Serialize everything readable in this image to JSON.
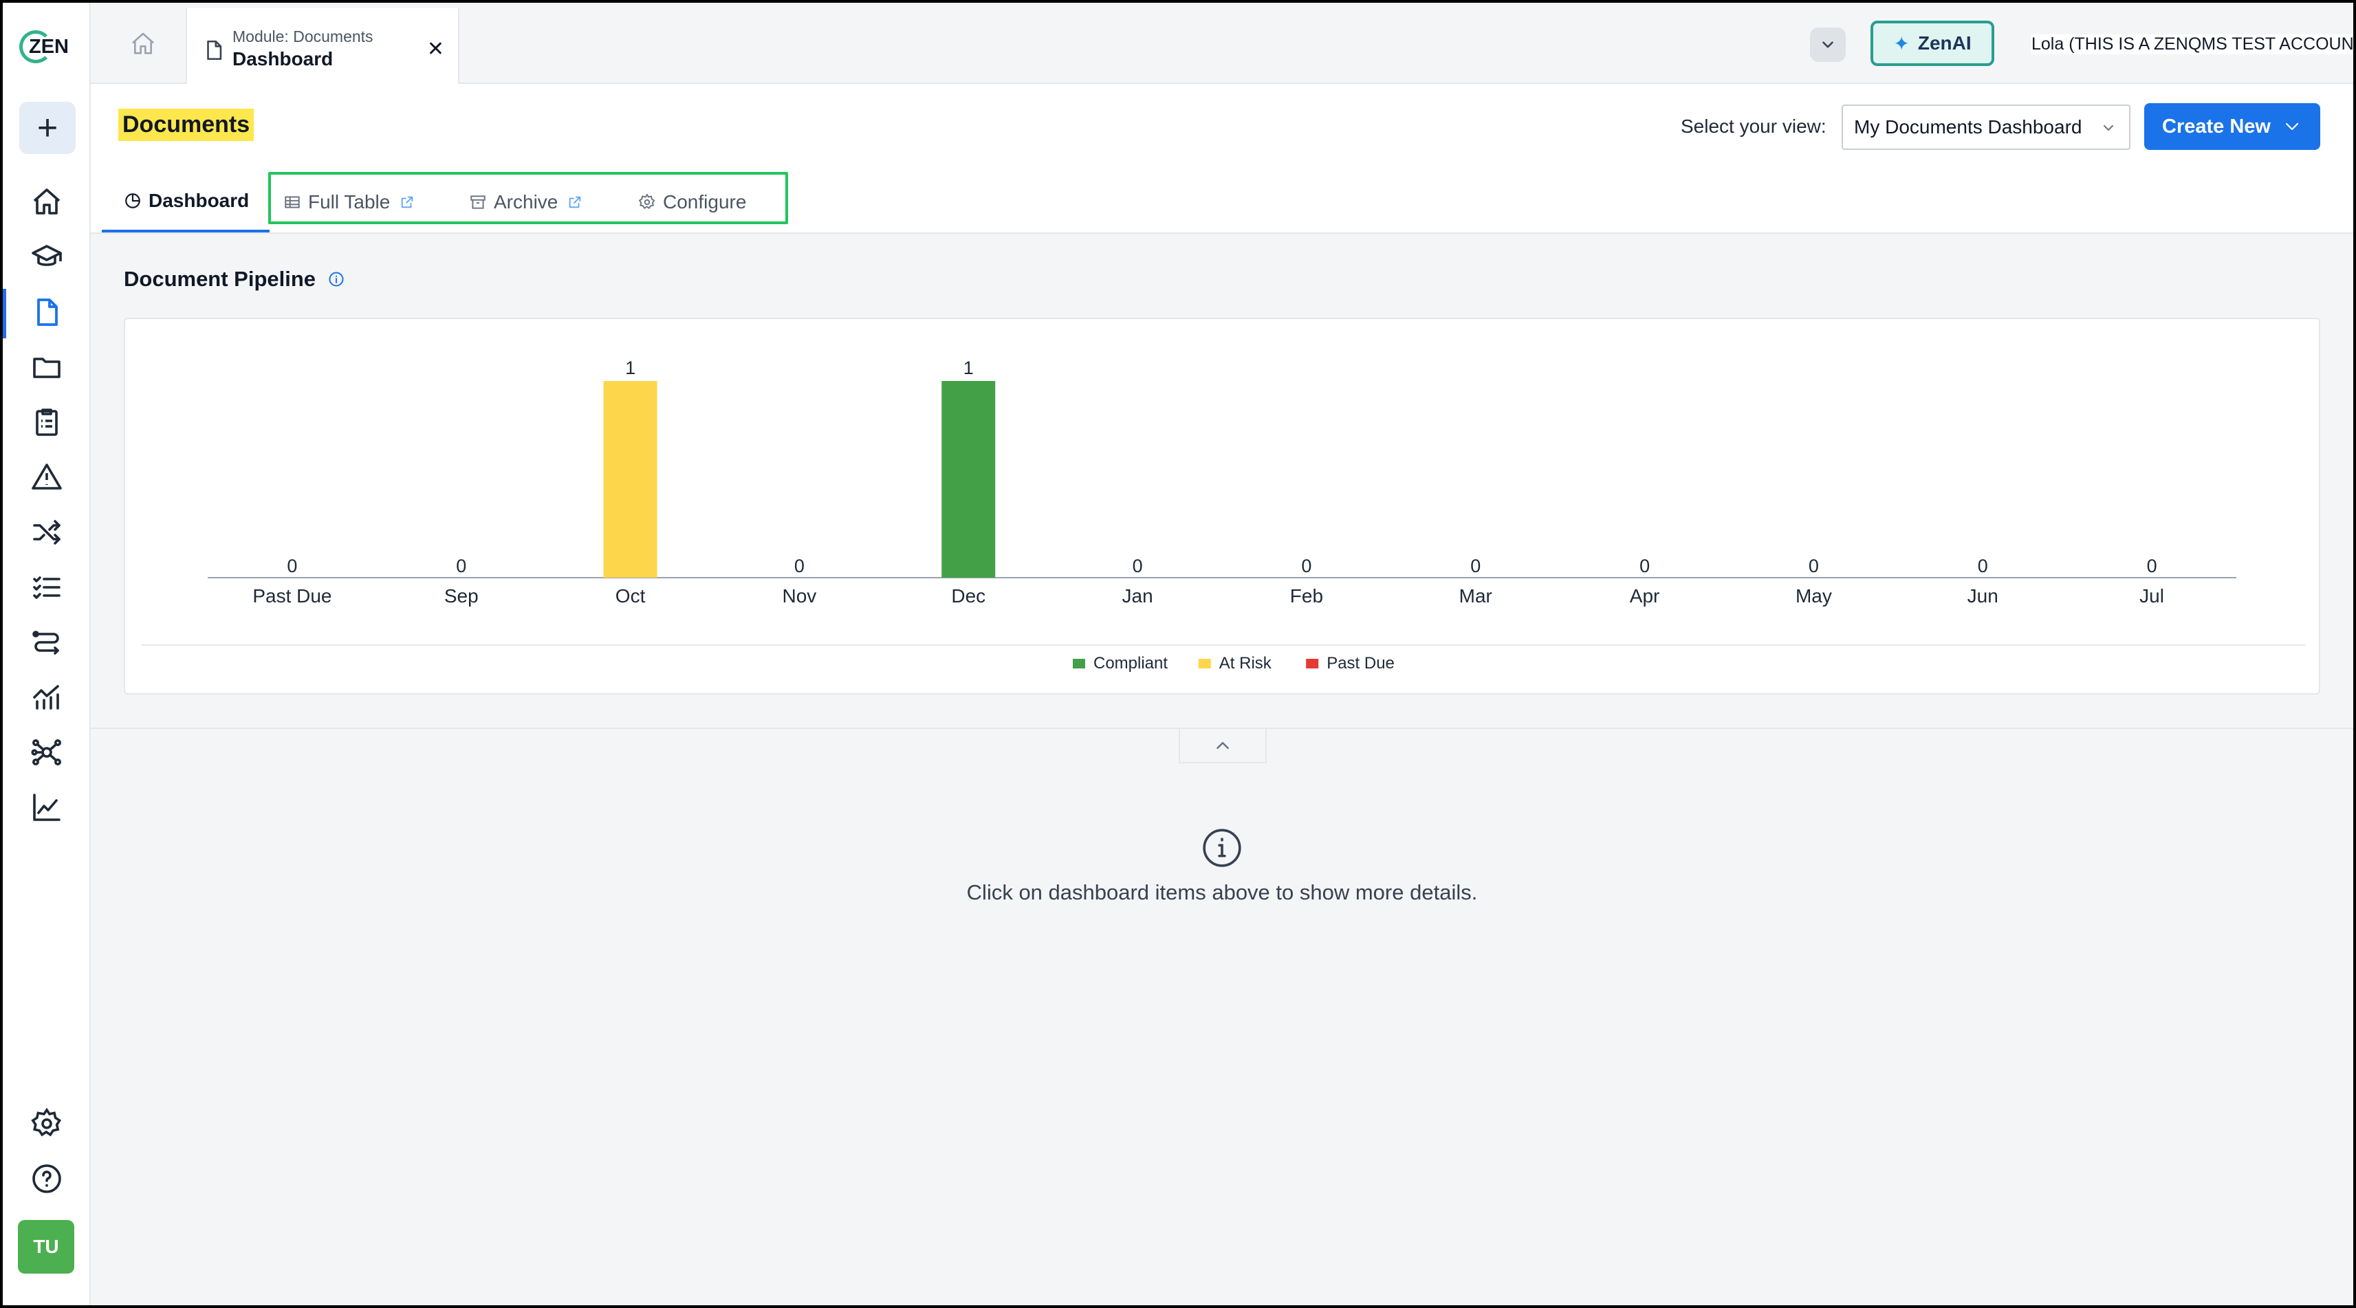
{
  "brand": {
    "name": "ZEN"
  },
  "topbar": {
    "tab": {
      "module_label": "Module: Documents",
      "title": "Dashboard"
    },
    "zenai_label": "ZenAI",
    "user": "Lola (THIS IS A ZENQMS TEST ACCOUNT)"
  },
  "sidebar": {
    "icons": [
      "home-icon",
      "graduation-cap-icon",
      "document-icon",
      "folder-icon",
      "clipboard-checklist-icon",
      "warning-triangle-icon",
      "shuffle-icon",
      "list-checks-icon",
      "workflow-icon",
      "analytics-icon",
      "network-icon",
      "line-chart-icon",
      "settings-icon",
      "help-icon"
    ],
    "avatar_initials": "TU"
  },
  "page": {
    "title": "Documents",
    "view_label": "Select your view:",
    "view_selected": "My Documents Dashboard",
    "create_label": "Create New"
  },
  "tabs": [
    {
      "label": "Dashboard",
      "active": true
    },
    {
      "label": "Full Table",
      "external": true
    },
    {
      "label": "Archive",
      "external": true
    },
    {
      "label": "Configure"
    }
  ],
  "pipeline": {
    "title": "Document Pipeline"
  },
  "chart_data": {
    "type": "bar",
    "categories": [
      "Past Due",
      "Sep",
      "Oct",
      "Nov",
      "Dec",
      "Jan",
      "Feb",
      "Mar",
      "Apr",
      "May",
      "Jun",
      "Jul"
    ],
    "series": [
      {
        "name": "Compliant",
        "color": "#43a047",
        "values": [
          0,
          0,
          0,
          0,
          1,
          0,
          0,
          0,
          0,
          0,
          0,
          0
        ]
      },
      {
        "name": "At Risk",
        "color": "#fdd64b",
        "values": [
          0,
          0,
          1,
          0,
          0,
          0,
          0,
          0,
          0,
          0,
          0,
          0
        ]
      },
      {
        "name": "Past Due",
        "color": "#e53935",
        "values": [
          0,
          0,
          0,
          0,
          0,
          0,
          0,
          0,
          0,
          0,
          0,
          0
        ]
      }
    ],
    "totals": [
      0,
      0,
      1,
      0,
      1,
      0,
      0,
      0,
      0,
      0,
      0,
      0
    ],
    "ylim": [
      0,
      1
    ],
    "grid": false,
    "legend": "bottom-center"
  },
  "empty_state": {
    "message": "Click on dashboard items above to show more details."
  },
  "colors": {
    "accent": "#1a73e8",
    "highlight": "#fde74c",
    "tab_outline": "#22c55e",
    "zenai": "#2a9d8f"
  }
}
